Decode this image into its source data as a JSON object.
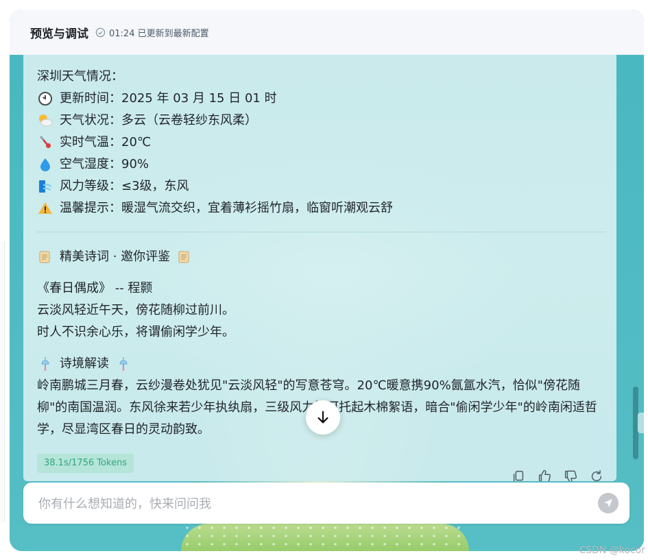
{
  "header": {
    "title": "预览与调试",
    "status": "01:24 已更新到最新配置"
  },
  "weather": {
    "heading": "深圳天气情况：",
    "items": [
      {
        "icon": "clock-icon",
        "text": "更新时间：2025 年 03 月 15 日 01 时"
      },
      {
        "icon": "sun-cloud-icon",
        "text": "天气状况：多云（云卷轻纱东风柔）"
      },
      {
        "icon": "thermometer-icon",
        "text": "实时气温：20℃"
      },
      {
        "icon": "droplet-icon",
        "text": "空气湿度：90%"
      },
      {
        "icon": "wind-icon",
        "text": "风力等级：≤3级，东风"
      },
      {
        "icon": "warning-icon",
        "text": "温馨提示：暖湿气流交织，宜着薄衫摇竹扇，临窗听潮观云舒"
      }
    ]
  },
  "poem": {
    "section_title": "精美诗词 · 邀你评鉴",
    "title": "《春日偶成》 -- 程颢",
    "lines": [
      "云淡风轻近午天，傍花随柳过前川。",
      "时人不识余心乐，将谓偷闲学少年。"
    ]
  },
  "interpretation": {
    "title": "诗境解读",
    "text": "岭南鹏城三月春，云纱漫卷处犹见\"云淡风轻\"的写意苍穹。20℃暖意携90%氤氲水汽，恰似\"傍花随柳\"的南国温润。东风徐来若少年执纨扇，三级风力恰可托起木棉絮语，暗合\"偷闲学少年\"的岭南闲适哲学，尽显湾区春日的灵动韵致。"
  },
  "stats": {
    "tokens": "38.1s/1756 Tokens"
  },
  "actions": {
    "copy": "copy-icon",
    "like": "thumbs-up-icon",
    "dislike": "thumbs-down-icon",
    "regenerate": "refresh-icon"
  },
  "input": {
    "placeholder": "你有什么想知道的，快来问问我",
    "value": ""
  },
  "watermark": "CSDN @kocor",
  "colors": {
    "accent": "#47b9c2",
    "token_text": "#2fa87a",
    "token_bg": "#b5e4d9"
  }
}
